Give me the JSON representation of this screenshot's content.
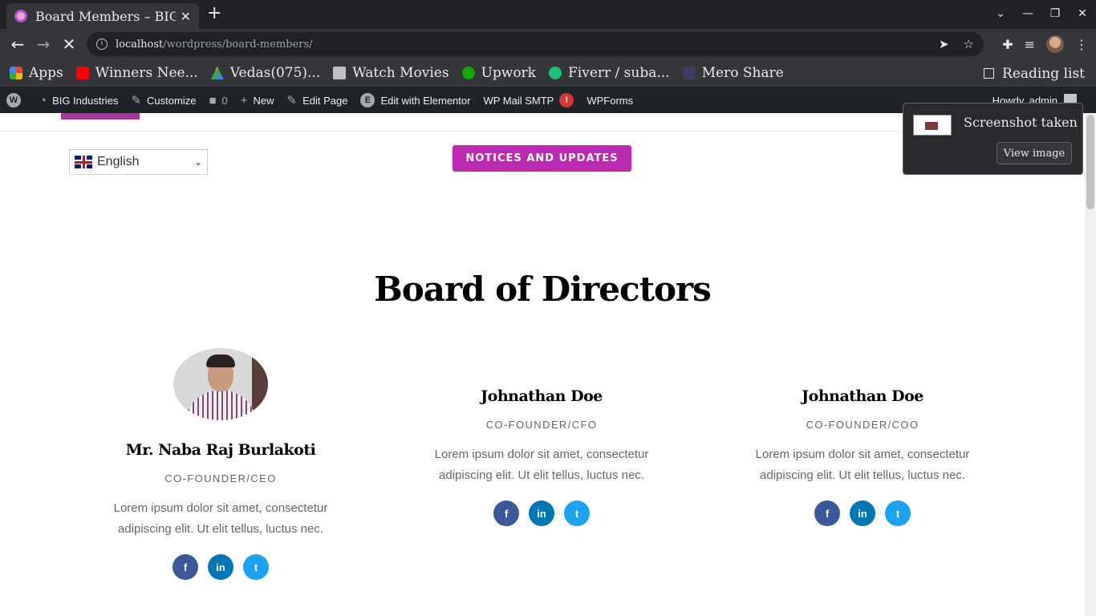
{
  "browser": {
    "tab_title": "Board Members – BIG",
    "tab_close": "✕",
    "new_tab": "+",
    "window_controls": [
      "⌄",
      "—",
      "❐",
      "✕"
    ],
    "url_host": "localhost",
    "url_path": "/wordpress/board-members/",
    "bookmarks": [
      {
        "label": "Apps",
        "icon": "apps-grid-icon"
      },
      {
        "label": "Winners Nee...",
        "icon": "youtube-icon"
      },
      {
        "label": "Vedas(075)...",
        "icon": "google-drive-icon"
      },
      {
        "label": "Watch Movies",
        "icon": "folder-icon"
      },
      {
        "label": "Upwork",
        "icon": "upwork-icon"
      },
      {
        "label": "Fiverr / suba...",
        "icon": "fiverr-icon"
      },
      {
        "label": "Mero Share",
        "icon": "mero-share-icon"
      }
    ],
    "reading_list": "Reading list"
  },
  "adminbar": {
    "site_name": "BIG Industries",
    "customize": "Customize",
    "comments_count": "0",
    "new": "New",
    "edit_page": "Edit Page",
    "edit_elementor": "Edit with Elementor",
    "wp_mail_smtp": "WP Mail SMTP",
    "smtp_badge": "!",
    "wpforms": "WPForms",
    "howdy": "Howdy, admin"
  },
  "page": {
    "language": "English",
    "notice_button": "NOTICES AND UPDATES",
    "section_title": "Board of Directors",
    "members": [
      {
        "name": "Mr. Naba Raj Burlakoti",
        "role": "CO-FOUNDER/CEO",
        "desc_line1": "Lorem ipsum dolor sit amet, consectetur",
        "desc_line2": "adipiscing elit. Ut elit tellus, luctus nec."
      },
      {
        "name": "Johnathan Doe",
        "role": "CO-FOUNDER/CFO",
        "desc_line1": "Lorem ipsum dolor sit amet, consectetur",
        "desc_line2": "adipiscing elit. Ut elit tellus, luctus nec."
      },
      {
        "name": "Johnathan Doe",
        "role": "CO-FOUNDER/COO",
        "desc_line1": "Lorem ipsum dolor sit amet, consectetur",
        "desc_line2": "adipiscing elit. Ut elit tellus, luctus nec."
      }
    ],
    "social_icons": [
      "facebook-icon",
      "linkedin-icon",
      "twitter-icon"
    ]
  },
  "toast": {
    "title": "Screenshot taken",
    "button": "View image"
  },
  "colors": {
    "accent": "#bd2ab1",
    "admin_bar": "#1d2327",
    "facebook": "#3b5998",
    "linkedin": "#0077b5",
    "twitter": "#1da1f2"
  }
}
